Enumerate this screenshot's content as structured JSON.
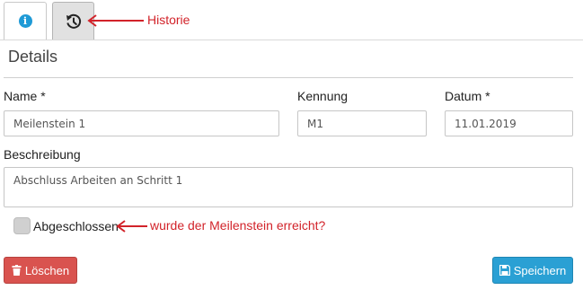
{
  "tabs": {
    "info_icon": "info-circle-icon",
    "history_icon": "history-icon"
  },
  "annotations": {
    "history": "Historie",
    "checkbox_hint": "wurde der Meilenstein erreicht?",
    "color": "#d2232a"
  },
  "section": {
    "title": "Details"
  },
  "form": {
    "name_label": "Name *",
    "name_value": "Meilenstein 1",
    "kennung_label": "Kennung",
    "kennung_value": "M1",
    "datum_label": "Datum *",
    "datum_value": "11.01.2019",
    "beschreibung_label": "Beschreibung",
    "beschreibung_value": "Abschluss Arbeiten an Schritt 1",
    "abgeschlossen_label": "Abgeschlossen",
    "abgeschlossen_checked": false
  },
  "buttons": {
    "delete_label": "Löschen",
    "save_label": "Speichern",
    "delete_color": "#d9534f",
    "save_color": "#2aa0d4"
  }
}
